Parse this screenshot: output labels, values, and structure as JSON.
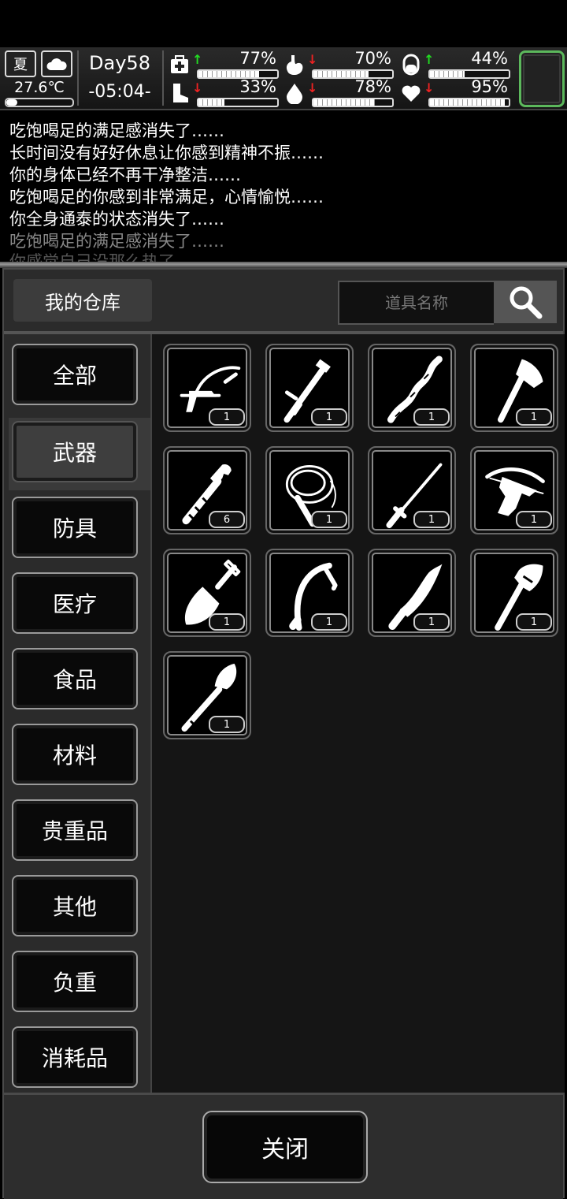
{
  "status": {
    "season": "夏",
    "temperature": "27.6℃",
    "day": "Day58",
    "clock": "-05:04-",
    "stats": [
      {
        "name": "health",
        "icon": "medkit-icon",
        "value": "77%",
        "trend": "up",
        "fill": 0.77
      },
      {
        "name": "hunger",
        "icon": "stomach-icon",
        "value": "70%",
        "trend": "down",
        "fill": 0.7
      },
      {
        "name": "mood",
        "icon": "pill-icon",
        "value": "44%",
        "trend": "up",
        "fill": 0.44
      },
      {
        "name": "stamina",
        "icon": "boot-icon",
        "value": "33%",
        "trend": "down",
        "fill": 0.33
      },
      {
        "name": "thirst",
        "icon": "water-drop-icon",
        "value": "78%",
        "trend": "down",
        "fill": 0.78
      },
      {
        "name": "spirit",
        "icon": "heart-icon",
        "value": "95%",
        "trend": "down",
        "fill": 0.95
      }
    ],
    "arrow_up_color": "#22dd22",
    "arrow_down_color": "#ee2222"
  },
  "log": [
    "吃饱喝足的满足感消失了……",
    "长时间没有好好休息让你感到精神不振……",
    "你的身体已经不再干净整洁……",
    "吃饱喝足的你感到非常满足，心情愉悦……",
    "你全身通泰的状态消失了……",
    "吃饱喝足的满足感消失了……",
    "你感觉自己没那么热了……"
  ],
  "storage": {
    "title": "我的仓库",
    "search_placeholder": "道具名称",
    "categories": [
      "全部",
      "武器",
      "防具",
      "医疗",
      "食品",
      "材料",
      "贵重品",
      "其他",
      "负重",
      "消耗品"
    ],
    "active_category": "武器",
    "items": [
      {
        "icon": "crossbow-pistol-icon",
        "count": "1"
      },
      {
        "icon": "baton-icon",
        "count": "1"
      },
      {
        "icon": "wooden-staff-icon",
        "count": "1"
      },
      {
        "icon": "axe-icon",
        "count": "1"
      },
      {
        "icon": "pipe-wrench-icon",
        "count": "6"
      },
      {
        "icon": "whip-icon",
        "count": "1"
      },
      {
        "icon": "katana-icon",
        "count": "1"
      },
      {
        "icon": "crossbow-icon",
        "count": "1"
      },
      {
        "icon": "shovel-icon",
        "count": "1"
      },
      {
        "icon": "sickle-icon",
        "count": "1"
      },
      {
        "icon": "machete-icon",
        "count": "1"
      },
      {
        "icon": "tactical-axe-icon",
        "count": "1"
      },
      {
        "icon": "spade-icon",
        "count": "1"
      }
    ],
    "close_label": "关闭"
  }
}
